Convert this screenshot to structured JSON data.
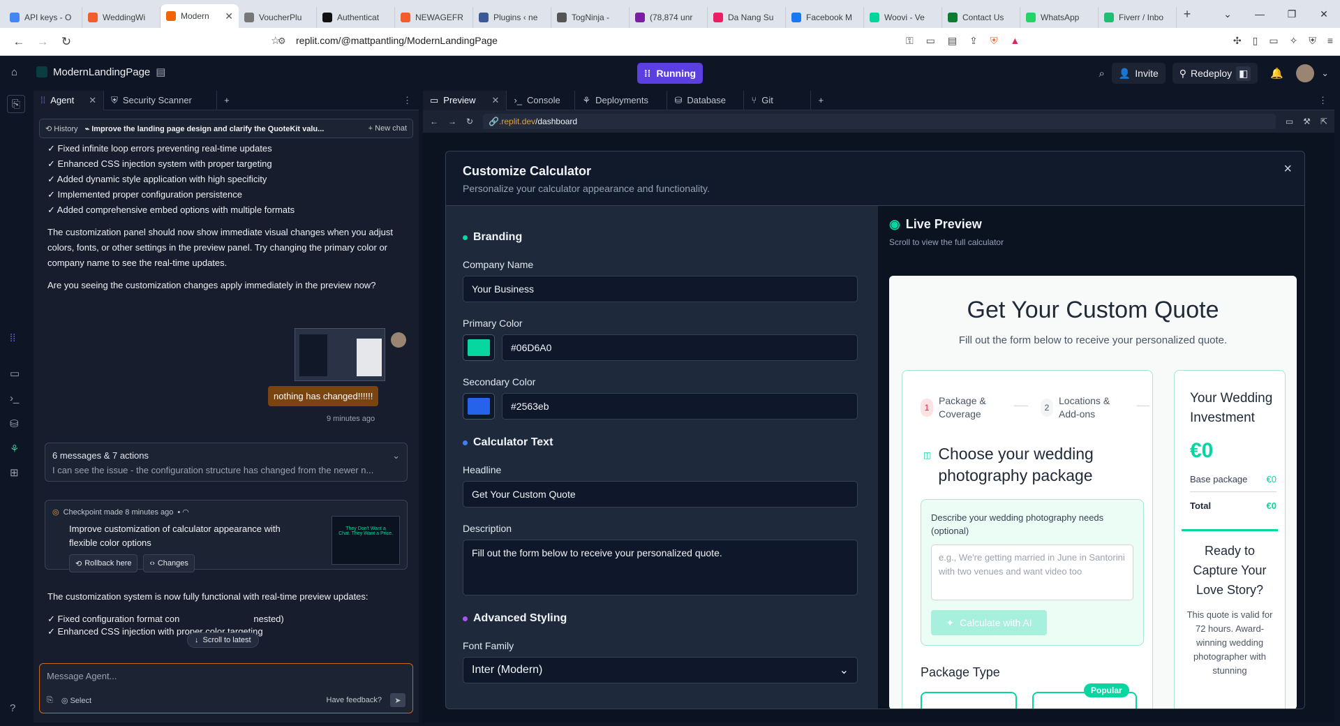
{
  "browser": {
    "tabs": [
      {
        "label": "API keys - O",
        "color": "#4285f4"
      },
      {
        "label": "WeddingWi",
        "color": "#f25c2a"
      },
      {
        "label": "Modern",
        "color": "#f26207",
        "active": true
      },
      {
        "label": "VoucherPlu",
        "color": "#777777"
      },
      {
        "label": "Authenticat",
        "color": "#111111"
      },
      {
        "label": "NEWAGEFR",
        "color": "#f25c2a"
      },
      {
        "label": "Plugins ‹ ne",
        "color": "#3b5998"
      },
      {
        "label": "TogNinja - ",
        "color": "#555555"
      },
      {
        "label": "(78,874 unr",
        "color": "#7b1fa2"
      },
      {
        "label": "Da Nang Su",
        "color": "#e91e63"
      },
      {
        "label": "Facebook M",
        "color": "#1877f2"
      },
      {
        "label": "Woovi - Ve",
        "color": "#03d69d"
      },
      {
        "label": "Contact Us",
        "color": "#0a7c2f"
      },
      {
        "label": "WhatsApp",
        "color": "#25d366"
      },
      {
        "label": "Fiverr / Inbo",
        "color": "#1dbf73"
      }
    ],
    "url": "replit.com/@mattpantling/ModernLandingPage"
  },
  "replit": {
    "project": "ModernLandingPage",
    "status": "Running",
    "invite": "Invite",
    "redeploy": "Redeploy"
  },
  "agent": {
    "tabs": [
      "Agent",
      "Security Scanner"
    ],
    "history": "History",
    "thread_title": "Improve the landing page design and clarify the QuoteKit valu...",
    "new_chat": "New chat",
    "checklist1": [
      "✓ Fixed infinite loop errors preventing real-time updates",
      "✓ Enhanced CSS injection system with proper targeting",
      "✓ Added dynamic style application with high specificity",
      "✓ Implemented proper configuration persistence",
      "✓ Added comprehensive embed options with multiple formats"
    ],
    "para1": "The customization panel should now show immediate visual changes when you adjust colors, fonts, or other settings in the preview panel. Try changing the primary color or company name to see the real-time updates.",
    "para2": "Are you seeing the customization changes apply immediately in the preview now?",
    "user_msg": "nothing has changed!!!!!!",
    "user_time": "9 minutes ago",
    "actions_title": "6 messages & 7 actions",
    "actions_sub": "I can see the issue - the configuration structure has changed from the newer n...",
    "checkpoint_meta": "Checkpoint made 8 minutes ago",
    "checkpoint_title": "Improve customization of calculator appearance with flexible color options",
    "rollback": "Rollback here",
    "changes": "Changes",
    "para3": "The customization system is now fully functional with real-time preview updates:",
    "checklist2": [
      "✓ Fixed configuration format con",
      "✓ Enhanced CSS injection with proper color targeting"
    ],
    "nested": "nested)",
    "scroll_latest": "Scroll to latest",
    "placeholder": "Message Agent...",
    "select": "Select",
    "feedback": "Have feedback?"
  },
  "workspace": {
    "tabs": [
      "Preview",
      "Console",
      "Deployments",
      "Database",
      "Git"
    ],
    "url_prefix": ".replit.dev",
    "url_path": "/dashboard"
  },
  "modal": {
    "title": "Customize Calculator",
    "subtitle": "Personalize your calculator appearance and functionality.",
    "branding": "Branding",
    "company_label": "Company Name",
    "company_value": "Your Business",
    "primary_label": "Primary Color",
    "primary_value": "#06D6A0",
    "primary_hex": "#06D6A0",
    "secondary_label": "Secondary Color",
    "secondary_value": "#2563eb",
    "secondary_hex": "#2563eb",
    "calc_text": "Calculator Text",
    "headline_label": "Headline",
    "headline_value": "Get Your Custom Quote",
    "desc_label": "Description",
    "desc_value": "Fill out the form below to receive your personalized quote.",
    "advanced": "Advanced Styling",
    "font_label": "Font Family",
    "font_value": "Inter (Modern)"
  },
  "live": {
    "title": "Live Preview",
    "subtitle": "Scroll to view the full calculator",
    "q_title": "Get Your Custom Quote",
    "q_desc": "Fill out the form below to receive your personalized quote.",
    "step1": "Package & Coverage",
    "step2": "Locations & Add-ons",
    "choose": "Choose your wedding photography package",
    "describe": "Describe your wedding photography needs (optional)",
    "describe_ph": "e.g., We're getting married in June in Santorini with two venues and want video too",
    "calc_ai": "Calculate with AI",
    "package_type": "Package Type",
    "popular": "Popular",
    "sum_title": "Your Wedding Investment",
    "sum_amount": "€0",
    "base_label": "Base package",
    "base_value": "€0",
    "total_label": "Total",
    "total_value": "€0",
    "cta": "Ready to Capture Your Love Story?",
    "valid": "This quote is valid for 72 hours. Award-winning wedding photographer with stunning"
  }
}
